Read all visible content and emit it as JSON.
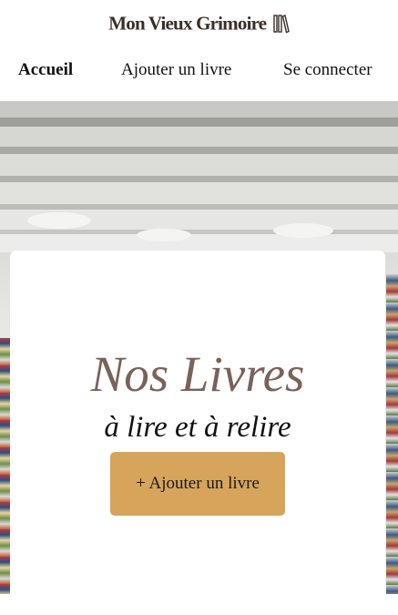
{
  "brand": {
    "name": "Mon Vieux Grimoire",
    "icon": "books-icon"
  },
  "nav": {
    "items": [
      {
        "label": "Accueil",
        "active": true
      },
      {
        "label": "Ajouter un livre",
        "active": false
      },
      {
        "label": "Se connecter",
        "active": false
      }
    ]
  },
  "hero": {
    "title": "Nos Livres",
    "subtitle": "à lire et à relire",
    "add_button": "+ Ajouter un livre"
  },
  "colors": {
    "brand_text": "#3a2d27",
    "title": "#7a6259",
    "button_bg": "#d7a45c"
  }
}
